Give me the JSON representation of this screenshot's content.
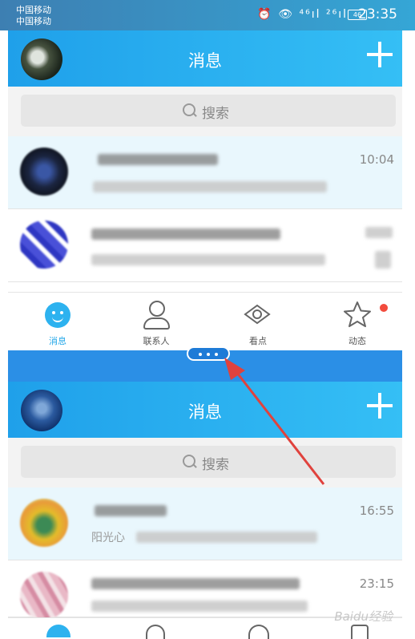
{
  "status_bar": {
    "carrier_1": "中国移动",
    "carrier_2": "中国移动",
    "indicators": "⏰ 👁 ⁴⁶ıl ²⁶ıl",
    "battery": "46",
    "time": "23:35"
  },
  "top_panel": {
    "title": "消息",
    "search_placeholder": "搜索",
    "conversations": [
      {
        "name": "",
        "preview": "",
        "time": "10:04"
      },
      {
        "name": "",
        "preview": "",
        "time": ""
      }
    ],
    "tabs": [
      {
        "label": "消息",
        "icon": "message-smile-icon",
        "active": true
      },
      {
        "label": "联系人",
        "icon": "contact-person-icon",
        "active": false
      },
      {
        "label": "看点",
        "icon": "eye-icon",
        "active": false
      },
      {
        "label": "动态",
        "icon": "star-icon",
        "active": false,
        "badge": true
      }
    ]
  },
  "bottom_panel": {
    "title": "消息",
    "search_placeholder": "搜索",
    "conversations": [
      {
        "name": "",
        "preview": "阳光心",
        "time": "16:55"
      },
      {
        "name": "",
        "preview": "",
        "time": "23:15"
      }
    ]
  },
  "colors": {
    "accent": "#1fa0ea",
    "divider": "#2b8fe6",
    "arrow": "#e0423d",
    "badge": "#f24b3d"
  },
  "watermark": "Baidu经验"
}
